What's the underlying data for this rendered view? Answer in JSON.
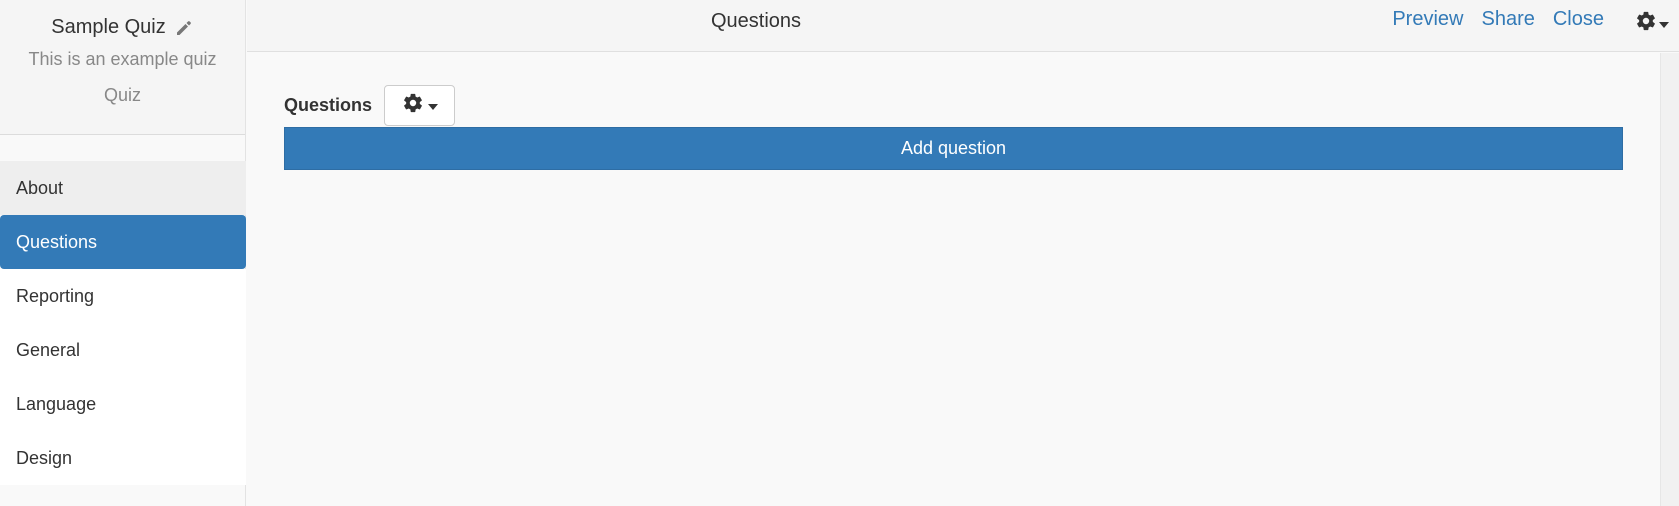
{
  "quiz": {
    "title": "Sample Quiz",
    "description": "This is an example quiz",
    "type": "Quiz"
  },
  "sidebar": {
    "items": [
      {
        "label": "About"
      },
      {
        "label": "Questions"
      },
      {
        "label": "Reporting"
      },
      {
        "label": "General"
      },
      {
        "label": "Language"
      },
      {
        "label": "Design"
      }
    ],
    "active": "Questions"
  },
  "topbar": {
    "title": "Questions",
    "links": {
      "preview": "Preview",
      "share": "Share",
      "close": "Close"
    },
    "settings_icon": "gear-icon"
  },
  "main": {
    "questions_label": "Questions",
    "settings_icon": "gear-icon",
    "add_question_label": "Add question"
  },
  "colors": {
    "accent": "#337ab7",
    "link": "#337ab7",
    "background": "#f9f9f9"
  }
}
